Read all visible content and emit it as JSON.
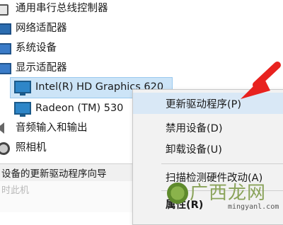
{
  "device_tree": {
    "items": [
      {
        "label": "通用串行总线控制器",
        "icon": "usb-controller-icon"
      },
      {
        "label": "网络适配器",
        "icon": "network-adapter-icon"
      },
      {
        "label": "系统设备",
        "icon": "system-device-icon"
      },
      {
        "label": "显示适配器",
        "icon": "display-adapter-icon"
      },
      {
        "label": "Intel(R) HD Graphics 620",
        "icon": "monitor-icon",
        "selected": true
      },
      {
        "label": "Radeon (TM) 530",
        "icon": "monitor-icon"
      },
      {
        "label": "音频输入和输出",
        "icon": "audio-icon"
      },
      {
        "label": "照相机",
        "icon": "camera-icon"
      }
    ]
  },
  "context_menu": {
    "items": [
      {
        "label": "更新驱动程序(P)",
        "highlighted": true
      },
      {
        "label": "禁用设备(D)"
      },
      {
        "label": "卸载设备(U)"
      },
      {
        "label": "扫描检测硬件改动(A)"
      },
      {
        "label": "属性(R)",
        "bold": true
      }
    ]
  },
  "status_bar": {
    "text": "设备的更新驱动程序向导",
    "ghost": "时此机"
  },
  "watermark": {
    "text": "广西龙网",
    "url": "mingyanl.com"
  },
  "colors": {
    "selection": "#cce4f7",
    "arrow": "#e8221f",
    "menu_bg": "#f2f2f2"
  }
}
